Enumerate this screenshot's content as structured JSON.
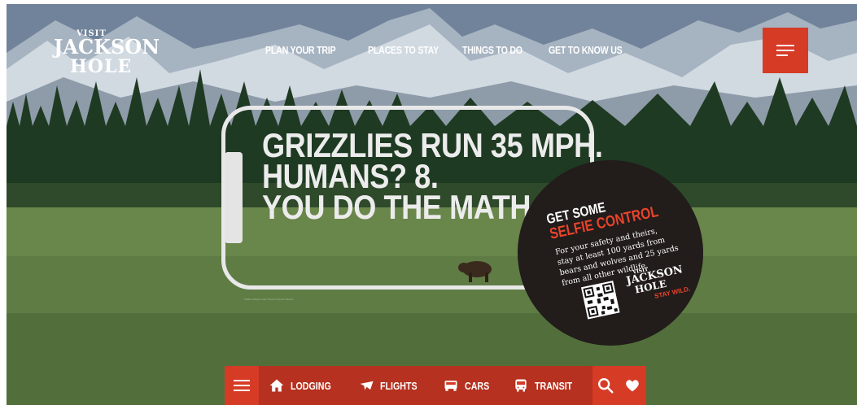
{
  "brand": {
    "line1": "VISIT",
    "line2": "JACKSON",
    "line3": "HOLE"
  },
  "nav": [
    "PLAN YOUR TRIP",
    "PLACES TO STAY",
    "THINGS TO DO",
    "GET TO KNOW US"
  ],
  "hero": {
    "headline": [
      "GRIZZLIES RUN 35 MPH.",
      "HUMANS? 8.",
      "YOU DO THE MATH."
    ],
    "credit": "©2021 Jackson Hole Travel & Tourism Board"
  },
  "badge": {
    "title1": "GET SOME",
    "title2": "SELFIE CONTROL",
    "body": "For your safety and theirs, stay at least 100 yards from bears and wolves and 25 yards from all other wildlife.",
    "logo_line1": "VISIT",
    "logo_line2": "JACKSON",
    "logo_line3": "HOLE",
    "tagline": "STAY WILD."
  },
  "bottom_bar": {
    "items": [
      {
        "label": "LODGING",
        "icon": "home-icon"
      },
      {
        "label": "FLIGHTS",
        "icon": "airplane-icon"
      },
      {
        "label": "CARS",
        "icon": "car-icon"
      },
      {
        "label": "TRANSIT",
        "icon": "bus-icon"
      }
    ],
    "search_icon": "search-icon",
    "favorites_icon": "heart-icon"
  },
  "colors": {
    "accent": "#d63b26",
    "accent_dark": "#b6311f",
    "badge_bg": "#221c1b"
  }
}
